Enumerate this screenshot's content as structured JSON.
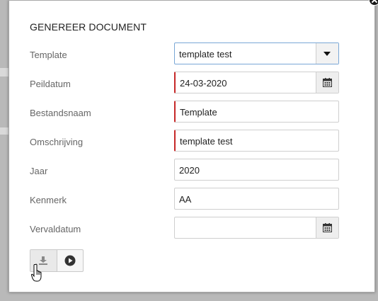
{
  "dialog": {
    "title": "GENEREER DOCUMENT"
  },
  "form": {
    "fields": [
      {
        "label": "Template",
        "value": "template test",
        "type": "select",
        "required": false
      },
      {
        "label": "Peildatum",
        "value": "24-03-2020",
        "type": "date",
        "required": true
      },
      {
        "label": "Bestandsnaam",
        "value": "Template",
        "type": "text",
        "required": true
      },
      {
        "label": "Omschrijving",
        "value": "template test",
        "type": "text",
        "required": true
      },
      {
        "label": "Jaar",
        "value": "2020",
        "type": "text",
        "required": false
      },
      {
        "label": "Kenmerk",
        "value": "AA",
        "type": "text",
        "required": false
      },
      {
        "label": "Vervaldatum",
        "value": "",
        "type": "date",
        "required": false
      }
    ]
  },
  "actions": {
    "download_icon": "download-icon",
    "play_icon": "play-icon"
  },
  "colors": {
    "required_marker": "#c62828",
    "select_focus_border": "#7aa7d6"
  }
}
